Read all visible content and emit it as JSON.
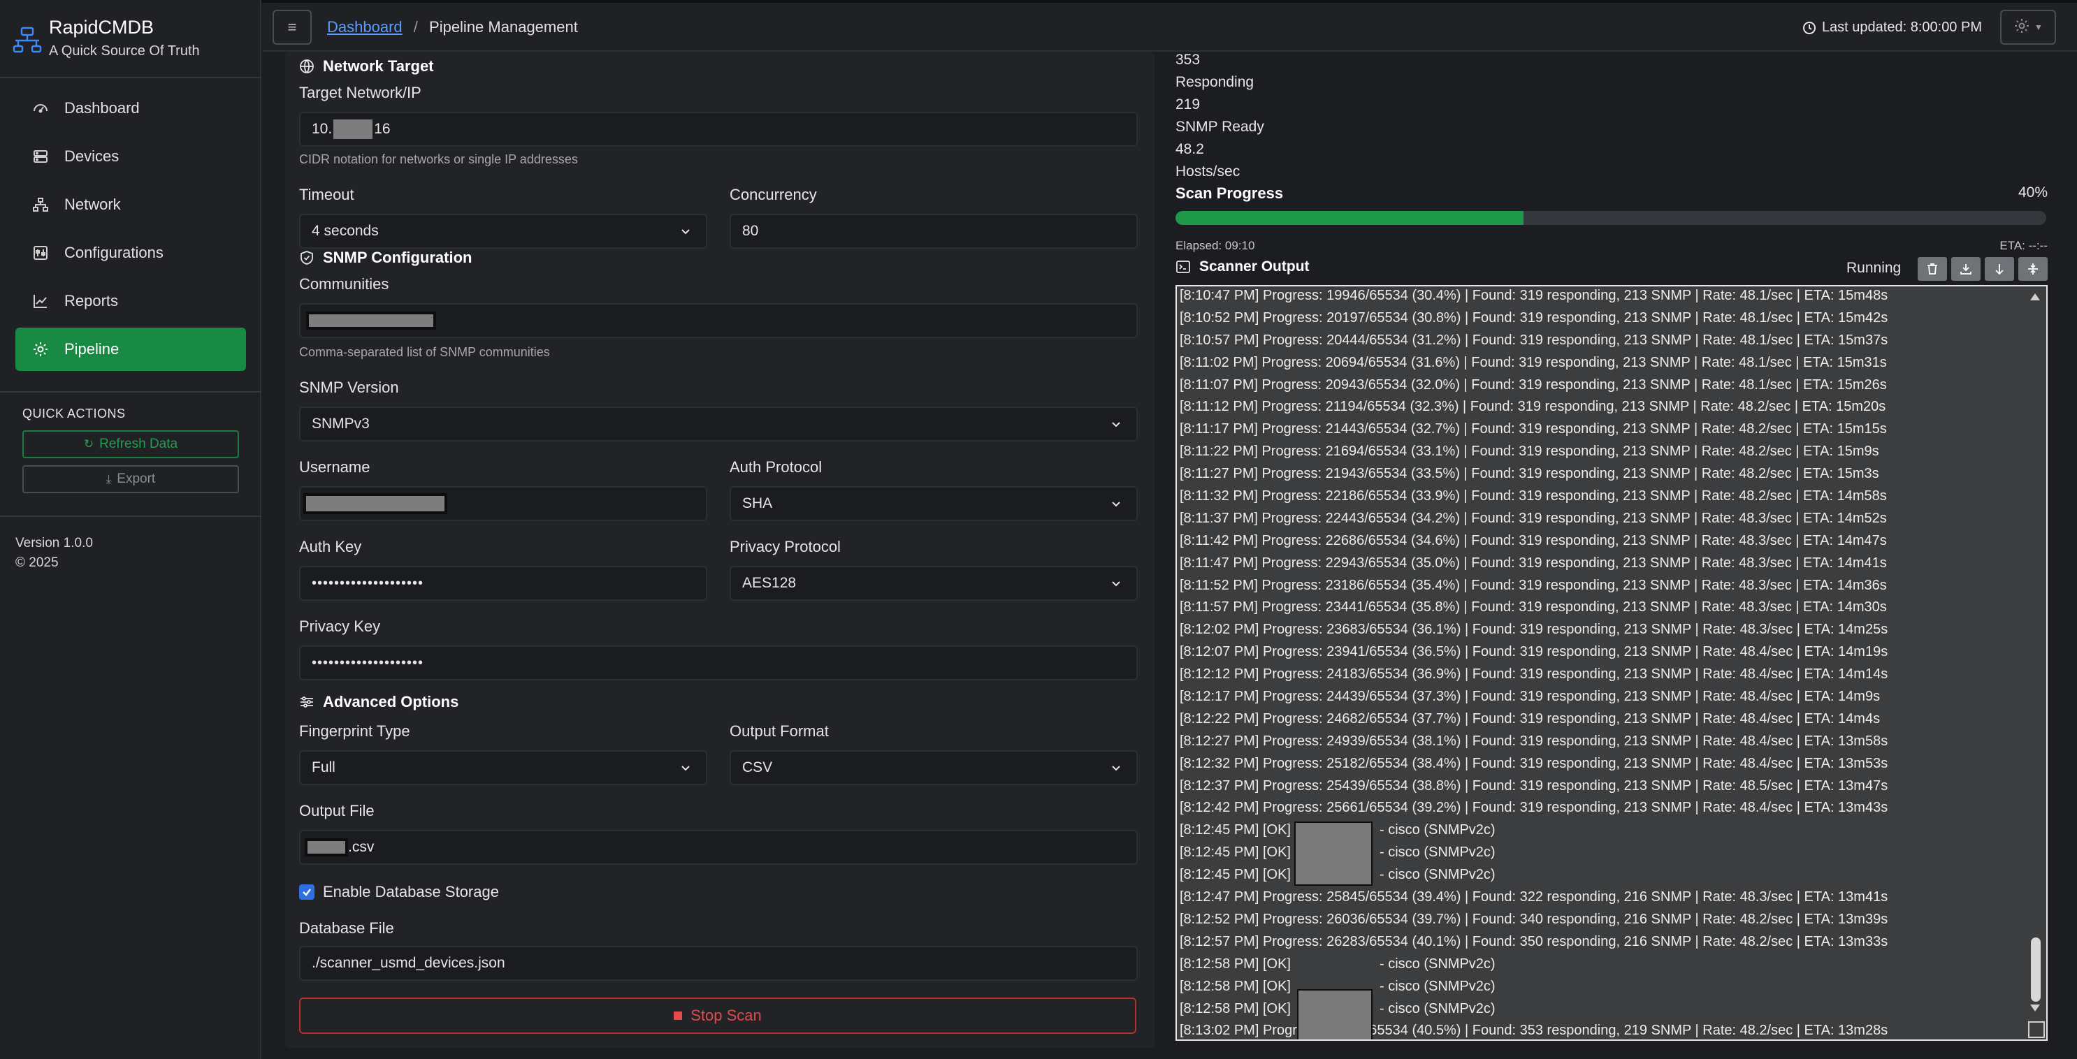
{
  "app": {
    "name": "RapidCMDB",
    "tagline": "A Quick Source Of Truth",
    "version": "Version 1.0.0",
    "copyright": "© 2025"
  },
  "nav": [
    {
      "label": "Dashboard",
      "icon": "gauge-icon"
    },
    {
      "label": "Devices",
      "icon": "server-icon"
    },
    {
      "label": "Network",
      "icon": "network-icon"
    },
    {
      "label": "Configurations",
      "icon": "sliders-icon"
    },
    {
      "label": "Reports",
      "icon": "chart-line-icon"
    },
    {
      "label": "Pipeline",
      "icon": "gear-icon",
      "active": true
    }
  ],
  "quick_actions": {
    "title": "QUICK ACTIONS",
    "refresh": "Refresh Data",
    "export": "Export"
  },
  "header": {
    "breadcrumb_root": "Dashboard",
    "breadcrumb_sep": "/",
    "breadcrumb_current": "Pipeline Management",
    "last_updated": "Last updated: 8:00:00 PM"
  },
  "form": {
    "network_target": {
      "title": "Network Target",
      "target_label": "Target Network/IP",
      "target_prefix": "10.",
      "target_suffix": "16",
      "target_help": "CIDR notation for networks or single IP addresses",
      "timeout_label": "Timeout",
      "timeout_value": "4 seconds",
      "concurrency_label": "Concurrency",
      "concurrency_value": "80"
    },
    "snmp": {
      "title": "SNMP Configuration",
      "communities_label": "Communities",
      "communities_help": "Comma-separated list of SNMP communities",
      "version_label": "SNMP Version",
      "version_value": "SNMPv3",
      "username_label": "Username",
      "auth_protocol_label": "Auth Protocol",
      "auth_protocol_value": "SHA",
      "auth_key_label": "Auth Key",
      "auth_key_value": "••••••••••••••••••••",
      "privacy_protocol_label": "Privacy Protocol",
      "privacy_protocol_value": "AES128",
      "privacy_key_label": "Privacy Key",
      "privacy_key_value": "••••••••••••••••••••"
    },
    "advanced": {
      "title": "Advanced Options",
      "fingerprint_label": "Fingerprint Type",
      "fingerprint_value": "Full",
      "output_format_label": "Output Format",
      "output_format_value": "CSV",
      "output_file_label": "Output File",
      "output_file_suffix": ".csv",
      "db_storage_label": "Enable Database Storage",
      "db_storage_checked": true,
      "db_file_label": "Database File",
      "db_file_value": "./scanner_usmd_devices.json"
    },
    "stop_button": "Stop Scan"
  },
  "stats": {
    "found_value": "353",
    "responding_label": "Responding",
    "responding_value": "219",
    "snmp_ready_label": "SNMP Ready",
    "rate_value": "48.2",
    "rate_label": "Hosts/sec"
  },
  "progress": {
    "title": "Scan Progress",
    "percent": 40,
    "percent_label": "40%",
    "elapsed": "Elapsed: 09:10",
    "eta": "ETA: --:--"
  },
  "output": {
    "title": "Scanner Output",
    "status": "Running",
    "lines": [
      "[8:10:47 PM] Progress: 19946/65534 (30.4%) | Found: 319 responding, 213 SNMP | Rate: 48.1/sec | ETA: 15m48s",
      "[8:10:52 PM] Progress: 20197/65534 (30.8%) | Found: 319 responding, 213 SNMP | Rate: 48.1/sec | ETA: 15m42s",
      "[8:10:57 PM] Progress: 20444/65534 (31.2%) | Found: 319 responding, 213 SNMP | Rate: 48.1/sec | ETA: 15m37s",
      "[8:11:02 PM] Progress: 20694/65534 (31.6%) | Found: 319 responding, 213 SNMP | Rate: 48.1/sec | ETA: 15m31s",
      "[8:11:07 PM] Progress: 20943/65534 (32.0%) | Found: 319 responding, 213 SNMP | Rate: 48.1/sec | ETA: 15m26s",
      "[8:11:12 PM] Progress: 21194/65534 (32.3%) | Found: 319 responding, 213 SNMP | Rate: 48.2/sec | ETA: 15m20s",
      "[8:11:17 PM] Progress: 21443/65534 (32.7%) | Found: 319 responding, 213 SNMP | Rate: 48.2/sec | ETA: 15m15s",
      "[8:11:22 PM] Progress: 21694/65534 (33.1%) | Found: 319 responding, 213 SNMP | Rate: 48.2/sec | ETA: 15m9s",
      "[8:11:27 PM] Progress: 21943/65534 (33.5%) | Found: 319 responding, 213 SNMP | Rate: 48.2/sec | ETA: 15m3s",
      "[8:11:32 PM] Progress: 22186/65534 (33.9%) | Found: 319 responding, 213 SNMP | Rate: 48.2/sec | ETA: 14m58s",
      "[8:11:37 PM] Progress: 22443/65534 (34.2%) | Found: 319 responding, 213 SNMP | Rate: 48.3/sec | ETA: 14m52s",
      "[8:11:42 PM] Progress: 22686/65534 (34.6%) | Found: 319 responding, 213 SNMP | Rate: 48.3/sec | ETA: 14m47s",
      "[8:11:47 PM] Progress: 22943/65534 (35.0%) | Found: 319 responding, 213 SNMP | Rate: 48.3/sec | ETA: 14m41s",
      "[8:11:52 PM] Progress: 23186/65534 (35.4%) | Found: 319 responding, 213 SNMP | Rate: 48.3/sec | ETA: 14m36s",
      "[8:11:57 PM] Progress: 23441/65534 (35.8%) | Found: 319 responding, 213 SNMP | Rate: 48.3/sec | ETA: 14m30s",
      "[8:12:02 PM] Progress: 23683/65534 (36.1%) | Found: 319 responding, 213 SNMP | Rate: 48.3/sec | ETA: 14m25s",
      "[8:12:07 PM] Progress: 23941/65534 (36.5%) | Found: 319 responding, 213 SNMP | Rate: 48.4/sec | ETA: 14m19s",
      "[8:12:12 PM] Progress: 24183/65534 (36.9%) | Found: 319 responding, 213 SNMP | Rate: 48.4/sec | ETA: 14m14s",
      "[8:12:17 PM] Progress: 24439/65534 (37.3%) | Found: 319 responding, 213 SNMP | Rate: 48.4/sec | ETA: 14m9s",
      "[8:12:22 PM] Progress: 24682/65534 (37.7%) | Found: 319 responding, 213 SNMP | Rate: 48.4/sec | ETA: 14m4s",
      "[8:12:27 PM] Progress: 24939/65534 (38.1%) | Found: 319 responding, 213 SNMP | Rate: 48.4/sec | ETA: 13m58s",
      "[8:12:32 PM] Progress: 25182/65534 (38.4%) | Found: 319 responding, 213 SNMP | Rate: 48.4/sec | ETA: 13m53s",
      "[8:12:37 PM] Progress: 25439/65534 (38.8%) | Found: 319 responding, 213 SNMP | Rate: 48.5/sec | ETA: 13m47s",
      "[8:12:42 PM] Progress: 25661/65534 (39.2%) | Found: 319 responding, 213 SNMP | Rate: 48.4/sec | ETA: 13m43s",
      "[8:12:45 PM] [OK]",
      "[8:12:45 PM] [OK]",
      "[8:12:45 PM] [OK]",
      "[8:12:47 PM] Progress: 25845/65534 (39.4%) | Found: 322 responding, 216 SNMP | Rate: 48.3/sec | ETA: 13m41s",
      "[8:12:52 PM] Progress: 26036/65534 (39.7%) | Found: 340 responding, 216 SNMP | Rate: 48.2/sec | ETA: 13m39s",
      "[8:12:57 PM] Progress: 26283/65534 (40.1%) | Found: 350 responding, 216 SNMP | Rate: 48.2/sec | ETA: 13m33s",
      "[8:12:58 PM] [OK]",
      "[8:12:58 PM] [OK]",
      "[8:12:58 PM] [OK]",
      "[8:13:02 PM] Progress: 26523/65534 (40.5%) | Found: 353 responding, 219 SNMP | Rate: 48.2/sec | ETA: 13m28s"
    ],
    "device_suffix": "- cisco (SNMPv2c)"
  },
  "colors": {
    "accent_green": "#198a44",
    "progress_green": "#1f9a4b",
    "link_blue": "#5b9cff",
    "danger_red": "#e24b4b"
  }
}
